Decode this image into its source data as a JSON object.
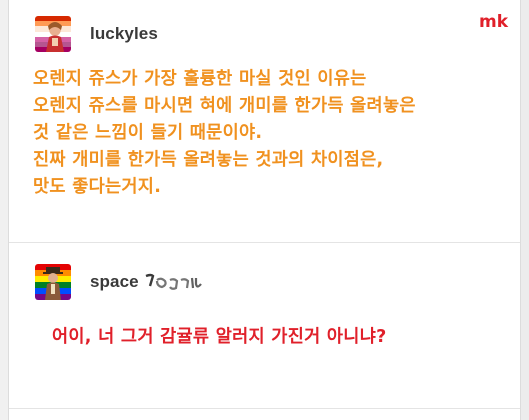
{
  "watermark": "mk",
  "post": {
    "username": "luckyles",
    "body_lines": [
      "오렌지 쥬스가 가장 훌륭한 마실 것인 이유는",
      "오렌지 쥬스를 마시면 혀에 개미를 한가득 올려놓은",
      "것 같은 느낌이 들기 때문이야.",
      "진짜 개미를 한가득 올려놓는 것과의 차이점은,",
      "맛도 좋다는거지."
    ],
    "text_color": "#f0911f"
  },
  "reply": {
    "username": "space",
    "text": "어이, 너 그거 감귤류 알러지 가진거 아니냐?",
    "text_color": "#e0202a"
  }
}
